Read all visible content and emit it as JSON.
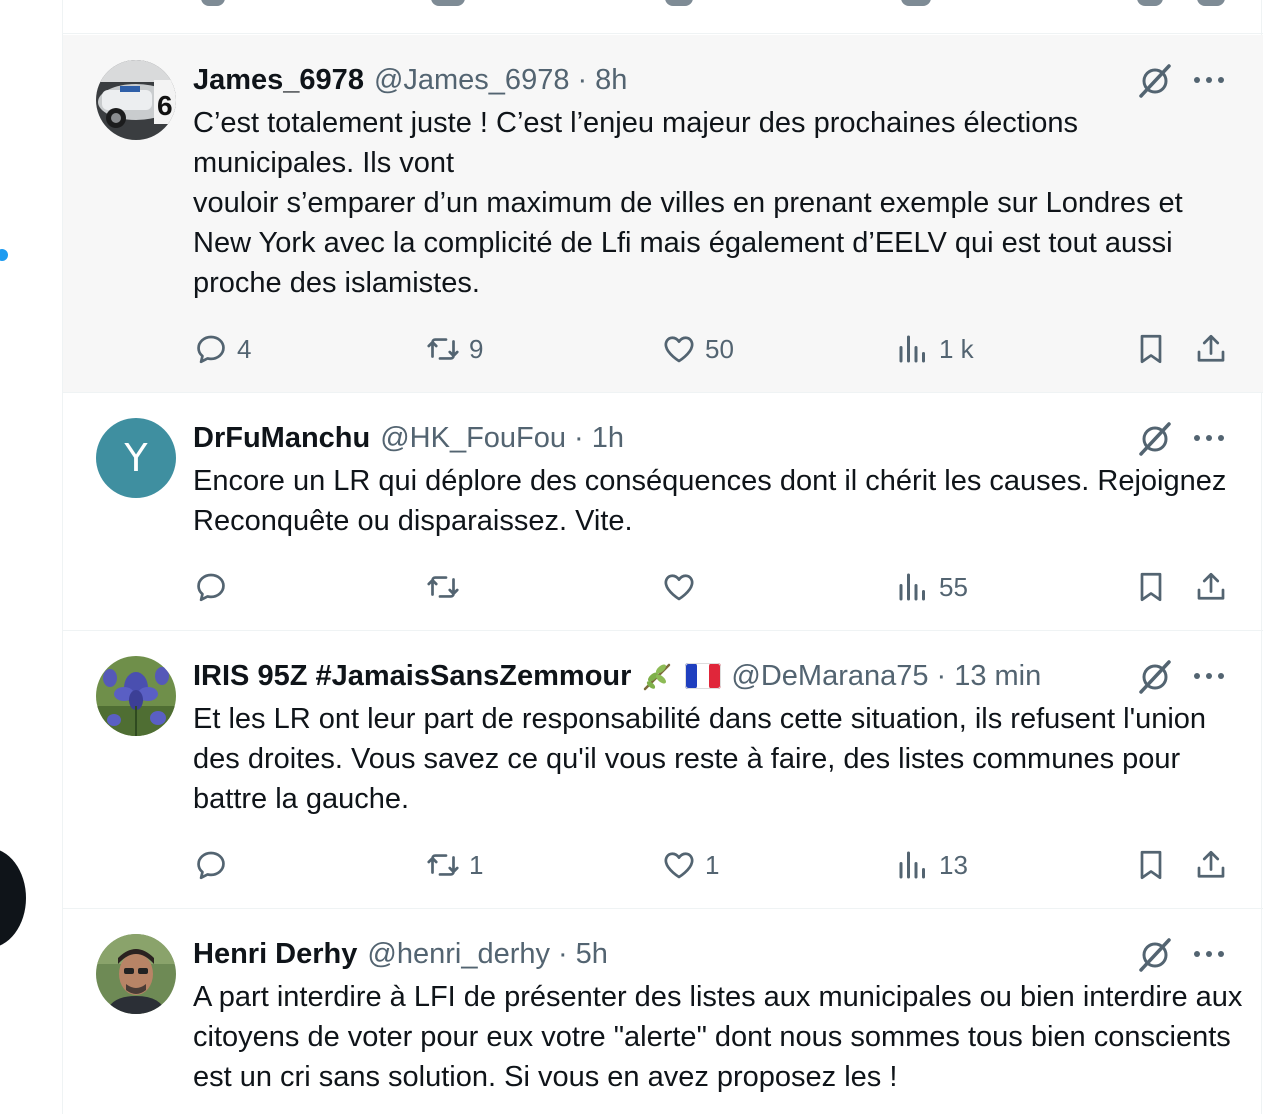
{
  "colors": {
    "accent": "#1d9bf0",
    "text": "#0f1419",
    "secondary": "#536471",
    "highlight_bg": "#f7f7f7",
    "border": "#eff3f4"
  },
  "tweets": [
    {
      "display_name": "James_6978",
      "handle": "@James_6978",
      "separator": "·",
      "time": "8h",
      "text": "C’est totalement juste ! C’est l’enjeu majeur des prochaines élections municipales. Ils vont\nvouloir s’emparer d’un maximum de villes en prenant exemple sur Londres et New York avec la complicité de Lfi mais également d’EELV qui est tout aussi proche des islamistes.",
      "replies": "4",
      "reposts": "9",
      "likes": "50",
      "views": "1 k",
      "avatar": "race-car-photo"
    },
    {
      "display_name": "DrFuManchu",
      "handle": "@HK_FouFou",
      "separator": "·",
      "time": "1h",
      "text": "Encore un LR qui déplore des conséquences dont il chérit les causes. Rejoignez Reconquête ou disparaissez. Vite.",
      "replies": "",
      "reposts": "",
      "likes": "",
      "views": "55",
      "avatar_letter": "Y",
      "avatar_color": "#3f8fa0"
    },
    {
      "display_name": "IRIS 95Z #JamaisSansZemmour",
      "emojis": [
        "olive-branch-emoji",
        "french-flag-emoji"
      ],
      "handle": "@DeMarana75",
      "separator": "·",
      "time": "13 min",
      "text": "Et les LR ont leur part de responsabilité dans cette situation,  ils refusent l'union des droites. Vous savez ce qu'il vous reste à  faire, des listes communes pour battre la gauche.",
      "replies": "",
      "reposts": "1",
      "likes": "1",
      "views": "13",
      "avatar": "iris-flower-photo"
    },
    {
      "display_name": "Henri Derhy",
      "handle": "@henri_derhy",
      "separator": "·",
      "time": "5h",
      "text": "A part interdire à LFI de présenter des listes aux municipales ou bien interdire aux citoyens de voter pour eux votre \"alerte\" dont nous sommes tous bien conscients est un cri sans solution. Si vous en avez proposez les !",
      "avatar": "man-portrait-photo"
    }
  ],
  "icons": {
    "reply": "reply-icon",
    "repost": "repost-icon",
    "like": "like-icon",
    "views": "views-icon",
    "bookmark": "bookmark-icon",
    "share": "share-icon",
    "grok": "grok-icon",
    "more": "more-icon"
  }
}
